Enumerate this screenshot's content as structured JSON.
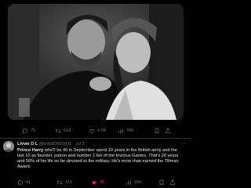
{
  "top_actions": {
    "replies": "75",
    "retweets": "518",
    "likes": "4.6K",
    "views": "78K"
  },
  "reply": {
    "name": "Livvie O L",
    "handle": "@lydia83691831",
    "separator": "·",
    "date": "Jul 3",
    "more": "···",
    "text_bold": "Prince Harry",
    "text_rest": " who'll be 40 in September spent 10 years in the British army and the last 10 as founder, patron and number 1 fan of the Invictus Games. That's 20 years and 50% of his life so far devoted to the military.  He's more than earned the Tillman Award."
  },
  "bottom_actions": {
    "replies": "41",
    "retweets": "315",
    "likes": "3K",
    "views": "25K"
  },
  "colors": {
    "background": "#000000",
    "text": "#e7e9ea",
    "muted": "#71767b",
    "liked": "#f91880"
  }
}
